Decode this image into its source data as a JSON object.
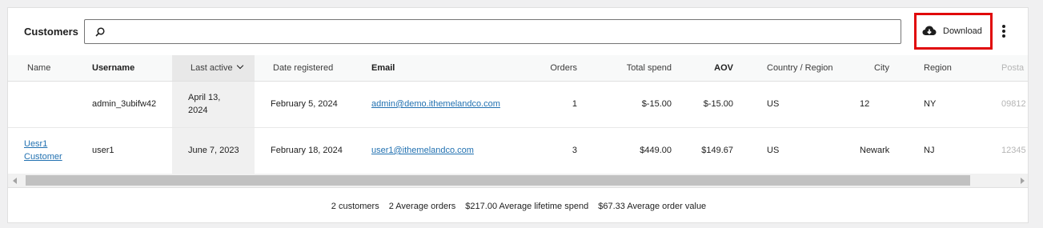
{
  "header": {
    "title": "Customers",
    "search_placeholder": "",
    "download_label": "Download"
  },
  "columns": [
    "Name",
    "Username",
    "Last active",
    "Date registered",
    "Email",
    "Orders",
    "Total spend",
    "AOV",
    "Country / Region",
    "City",
    "Region",
    "Posta"
  ],
  "rows": [
    {
      "name": "",
      "username": "admin_3ubifw42",
      "last_active": "April 13, 2024",
      "date_registered": "February 5, 2024",
      "email": "admin@demo.ithemelandco.com",
      "orders": "1",
      "total_spend": "$-15.00",
      "aov": "$-15.00",
      "country": "US",
      "city": "12",
      "region": "NY",
      "postal": "09812"
    },
    {
      "name": "Uesr1 Customer",
      "username": "user1",
      "last_active": "June 7, 2023",
      "date_registered": "February 18, 2024",
      "email": "user1@ithemelandco.com",
      "orders": "3",
      "total_spend": "$449.00",
      "aov": "$149.67",
      "country": "US",
      "city": "Newark",
      "region": "NJ",
      "postal": "12345"
    }
  ],
  "footer": {
    "customers": "2 customers",
    "avg_orders": "2 Average orders",
    "avg_lifetime": "$217.00 Average lifetime spend",
    "avg_order_value": "$67.33 Average order value"
  },
  "colors": {
    "accent_link": "#2271b1",
    "highlight_border": "#e0080a"
  }
}
